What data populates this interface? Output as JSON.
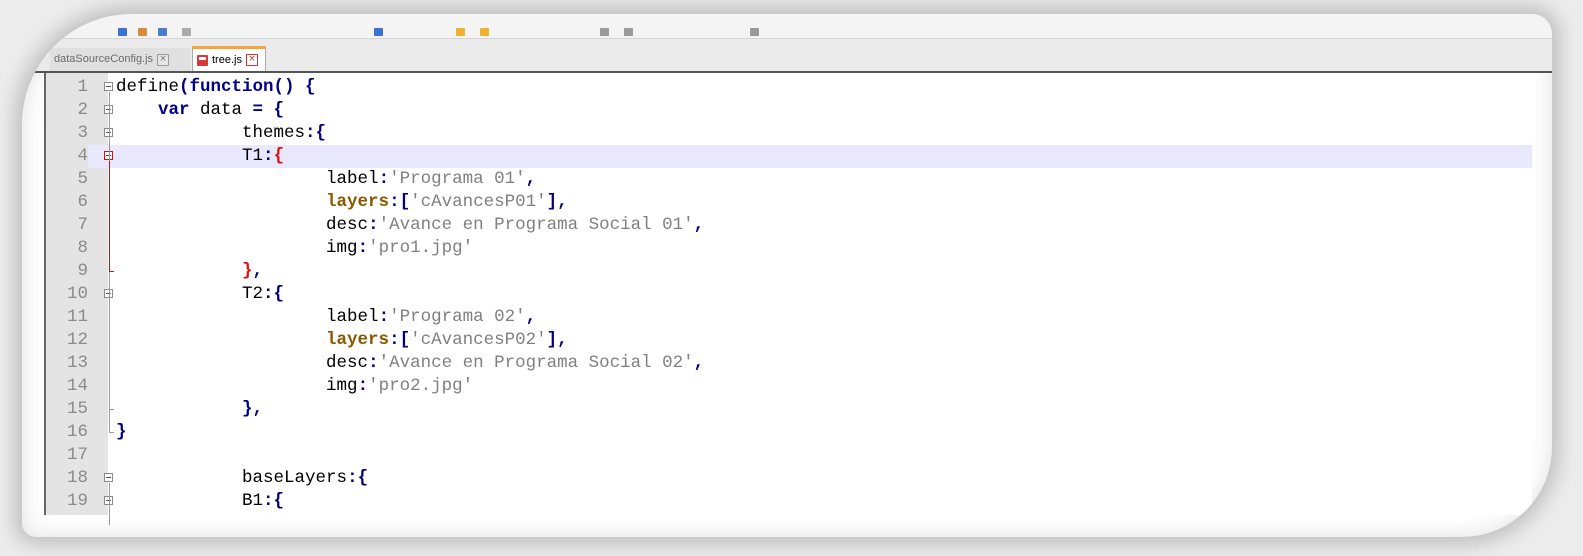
{
  "tabs": [
    {
      "label": "dataSourceConfig.js",
      "active": false
    },
    {
      "label": "tree.js",
      "active": true
    }
  ],
  "editor": {
    "current_line": 4,
    "lines": [
      {
        "n": "1",
        "indent": "",
        "segs": [
          [
            "t",
            "define"
          ],
          [
            "p",
            "("
          ],
          [
            "k",
            "function"
          ],
          [
            "p",
            "() {"
          ]
        ]
      },
      {
        "n": "2",
        "indent": "    ",
        "segs": [
          [
            "k",
            "var"
          ],
          [
            "t",
            " data "
          ],
          [
            "p",
            "= {"
          ]
        ]
      },
      {
        "n": "3",
        "indent": "            ",
        "segs": [
          [
            "t",
            "themes"
          ],
          [
            "p",
            ":{"
          ]
        ]
      },
      {
        "n": "4",
        "indent": "            ",
        "segs": [
          [
            "t",
            "T1"
          ],
          [
            "p",
            ":"
          ],
          [
            "pr",
            "{"
          ]
        ]
      },
      {
        "n": "5",
        "indent": "                    ",
        "segs": [
          [
            "t",
            "label"
          ],
          [
            "p",
            ":"
          ],
          [
            "s",
            "'Programa 01'"
          ],
          [
            "p",
            ","
          ]
        ]
      },
      {
        "n": "6",
        "indent": "                    ",
        "segs": [
          [
            "b",
            "layers"
          ],
          [
            "p",
            ":["
          ],
          [
            "s",
            "'cAvancesP01'"
          ],
          [
            "p",
            "],"
          ]
        ]
      },
      {
        "n": "7",
        "indent": "                    ",
        "segs": [
          [
            "t",
            "desc"
          ],
          [
            "p",
            ":"
          ],
          [
            "s",
            "'Avance en Programa Social 01'"
          ],
          [
            "p",
            ","
          ]
        ]
      },
      {
        "n": "8",
        "indent": "                    ",
        "segs": [
          [
            "t",
            "img"
          ],
          [
            "p",
            ":"
          ],
          [
            "s",
            "'pro1.jpg'"
          ]
        ]
      },
      {
        "n": "9",
        "indent": "            ",
        "segs": [
          [
            "pr",
            "}"
          ],
          [
            "p",
            ","
          ]
        ]
      },
      {
        "n": "10",
        "indent": "            ",
        "segs": [
          [
            "t",
            "T2"
          ],
          [
            "p",
            ":{"
          ]
        ]
      },
      {
        "n": "11",
        "indent": "                    ",
        "segs": [
          [
            "t",
            "label"
          ],
          [
            "p",
            ":"
          ],
          [
            "s",
            "'Programa 02'"
          ],
          [
            "p",
            ","
          ]
        ]
      },
      {
        "n": "12",
        "indent": "                    ",
        "segs": [
          [
            "b",
            "layers"
          ],
          [
            "p",
            ":["
          ],
          [
            "s",
            "'cAvancesP02'"
          ],
          [
            "p",
            "],"
          ]
        ]
      },
      {
        "n": "13",
        "indent": "                    ",
        "segs": [
          [
            "t",
            "desc"
          ],
          [
            "p",
            ":"
          ],
          [
            "s",
            "'Avance en Programa Social 02'"
          ],
          [
            "p",
            ","
          ]
        ]
      },
      {
        "n": "14",
        "indent": "                    ",
        "segs": [
          [
            "t",
            "img"
          ],
          [
            "p",
            ":"
          ],
          [
            "s",
            "'pro2.jpg'"
          ]
        ]
      },
      {
        "n": "15",
        "indent": "            ",
        "segs": [
          [
            "p",
            "},"
          ]
        ]
      },
      {
        "n": "16",
        "indent": "",
        "segs": [
          [
            "p",
            "}"
          ]
        ]
      },
      {
        "n": "17",
        "indent": "",
        "segs": []
      },
      {
        "n": "18",
        "indent": "            ",
        "segs": [
          [
            "t",
            "baseLayers"
          ],
          [
            "p",
            ":{"
          ]
        ]
      },
      {
        "n": "19",
        "indent": "            ",
        "segs": [
          [
            "t",
            "B1"
          ],
          [
            "p",
            ":{"
          ]
        ]
      }
    ],
    "fold_open_lines": [
      1,
      2,
      3,
      4,
      10,
      18,
      19
    ],
    "fold_end_lines": [
      9,
      15,
      16
    ],
    "highlight_fold_lines": [
      4,
      9
    ]
  }
}
